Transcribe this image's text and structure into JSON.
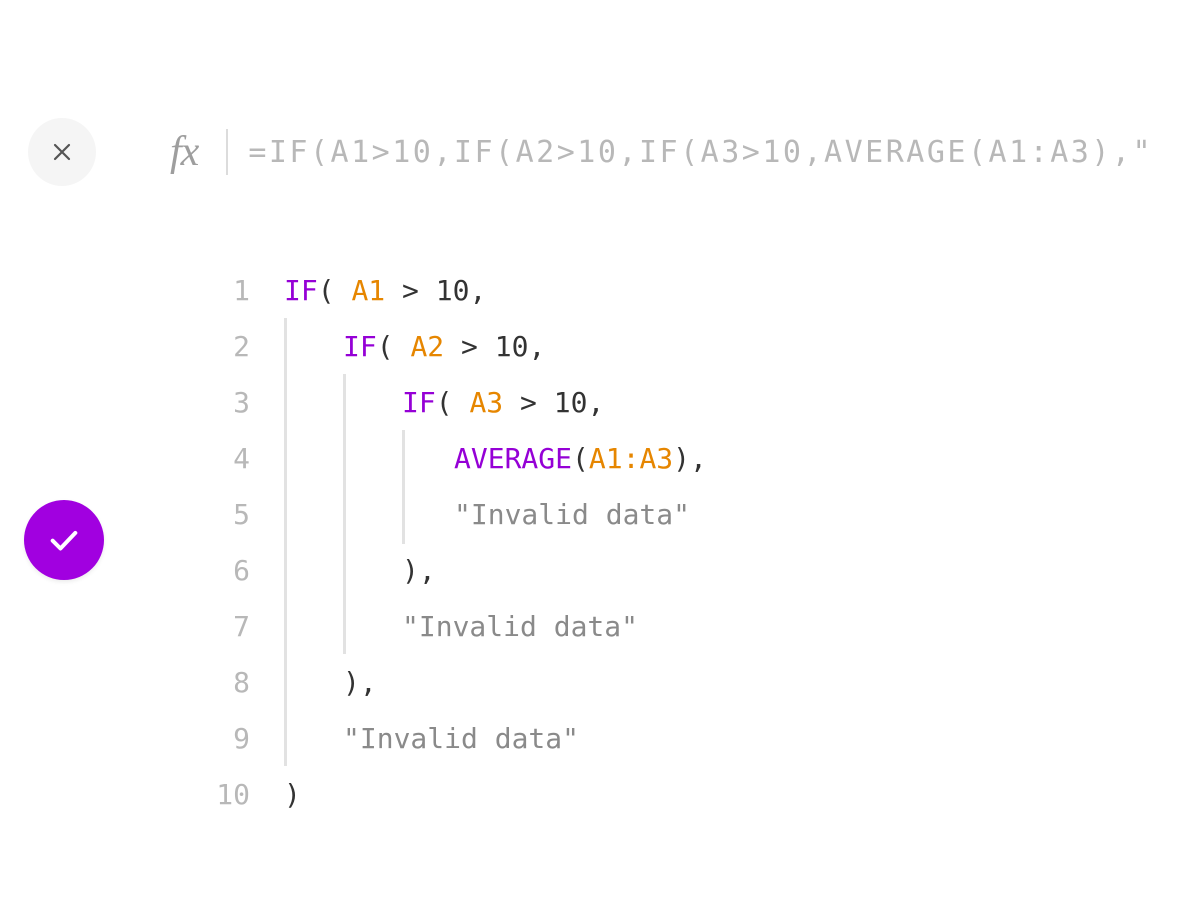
{
  "topbar": {
    "fx_symbol": "fx",
    "formula_text": "=IF(A1>10,IF(A2>10,IF(A3>10,AVERAGE(A1:A3),\""
  },
  "code": {
    "line_numbers": [
      "1",
      "2",
      "3",
      "4",
      "5",
      "6",
      "7",
      "8",
      "9",
      "10"
    ],
    "tokens": {
      "if": "IF",
      "average": "AVERAGE",
      "a1": "A1",
      "a2": "A2",
      "a3": "A3",
      "a1a3_left": "A1",
      "a1a3_right": "A3",
      "gt": ">",
      "ten": "10",
      "invalid": "\"Invalid data\"",
      "lp": "(",
      "rp": ")",
      "comma": ",",
      "colon": ":"
    }
  },
  "colors": {
    "function": "#9500d6",
    "reference": "#e68600",
    "string": "#8a8a8a",
    "line_number": "#b8b8b8",
    "accept_bg": "#a100e0"
  }
}
